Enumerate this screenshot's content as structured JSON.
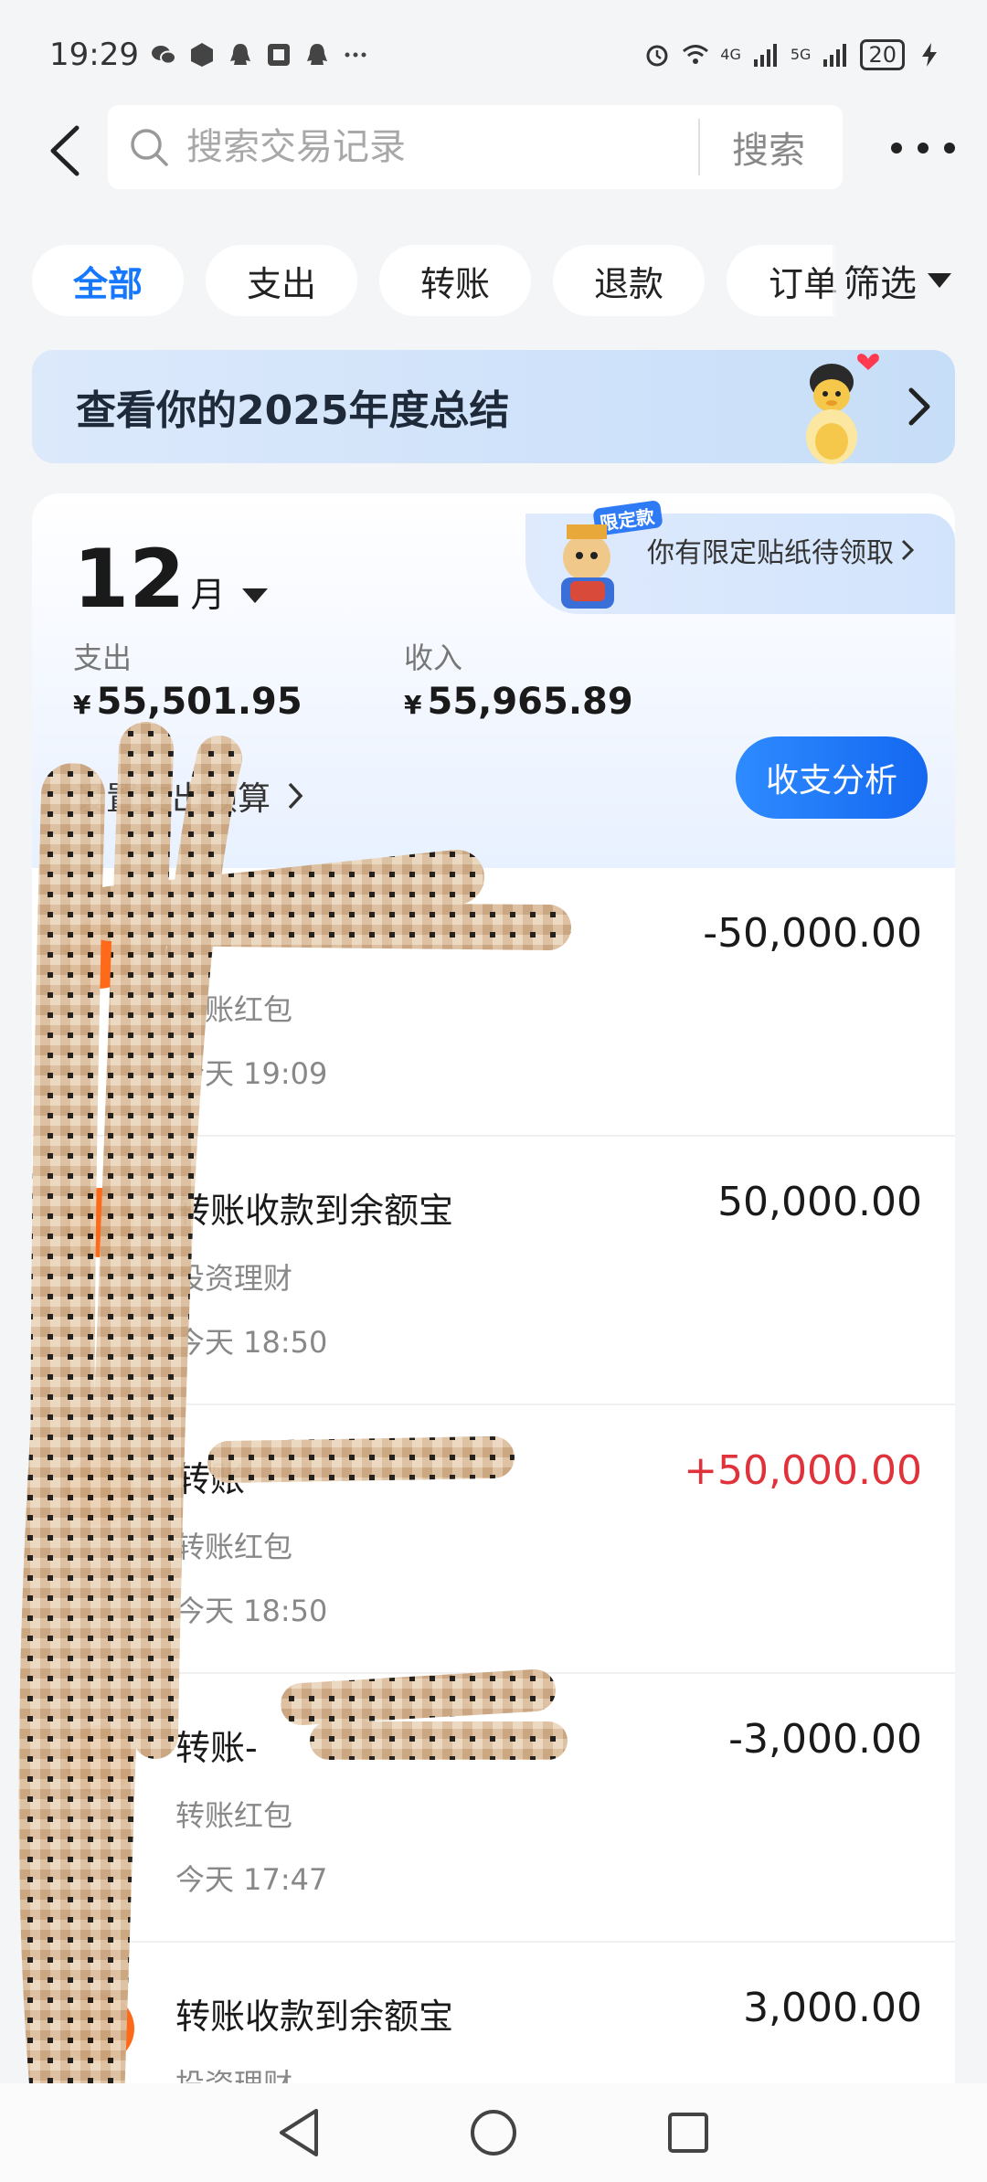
{
  "status": {
    "time": "19:29",
    "battery": "20",
    "net_a": "4G",
    "net_b": "5G"
  },
  "header": {
    "search_placeholder": "搜索交易记录",
    "search_button": "搜索"
  },
  "tabs": [
    {
      "label": "全部",
      "active": true
    },
    {
      "label": "支出",
      "active": false
    },
    {
      "label": "转账",
      "active": false
    },
    {
      "label": "退款",
      "active": false
    },
    {
      "label": "订单",
      "active": false
    }
  ],
  "filter_label": "筛选",
  "banner": {
    "text": "查看你的2025年度总结"
  },
  "summary": {
    "sticker_badge": "限定款",
    "sticker_text": "你有限定贴纸待领取",
    "month": "12",
    "month_unit": "月",
    "expense_label": "支出",
    "expense_value": "55,501.95",
    "income_label": "收入",
    "income_value": "55,965.89",
    "currency": "¥",
    "budget_link": "设置支出预算",
    "analysis_button": "收支分析"
  },
  "transactions": [
    {
      "title": "",
      "category": "转账红包",
      "time": "今天 19:09",
      "amount": "-50,000.00",
      "positive": false
    },
    {
      "title": "转账收款到余额宝",
      "category": "投资理财",
      "time": "今天 18:50",
      "amount": "50,000.00",
      "positive": false
    },
    {
      "title": "转账",
      "category": "转账红包",
      "time": "今天 18:50",
      "amount": "+50,000.00",
      "positive": true
    },
    {
      "title": "转账-",
      "category": "转账红包",
      "time": "今天 17:47",
      "amount": "-3,000.00",
      "positive": false
    },
    {
      "title": "转账收款到余额宝",
      "category": "投资理财",
      "time": "",
      "amount": "3,000.00",
      "positive": false
    }
  ],
  "colors": {
    "accent": "#1677ff",
    "positive_amount": "#e0323b",
    "redaction": "#d8b898"
  }
}
